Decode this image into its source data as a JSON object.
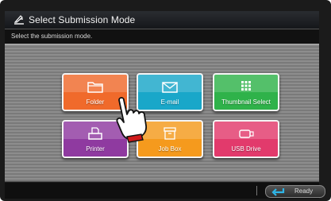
{
  "window": {
    "title": "Select Submission Mode"
  },
  "instruction": "Select the submission mode.",
  "modes": [
    {
      "label": "Folder",
      "icon": "folder-icon",
      "color": "#f06a2b"
    },
    {
      "label": "E-mail",
      "icon": "envelope-icon",
      "color": "#19a7c9"
    },
    {
      "label": "Thumbnail Select",
      "icon": "grid-icon",
      "color": "#2fb24a"
    },
    {
      "label": "Printer",
      "icon": "printer-icon",
      "color": "#8f3aa0"
    },
    {
      "label": "Job Box",
      "icon": "box-icon",
      "color": "#f59a1d"
    },
    {
      "label": "USB Drive",
      "icon": "usb-drive-icon",
      "color": "#e23a6c"
    }
  ],
  "status": {
    "ready_label": "Ready",
    "ready_icon": "return-arrow-icon",
    "accent": "#2fb6e8"
  },
  "pointer": {
    "icon": "hand-pointer-icon"
  }
}
